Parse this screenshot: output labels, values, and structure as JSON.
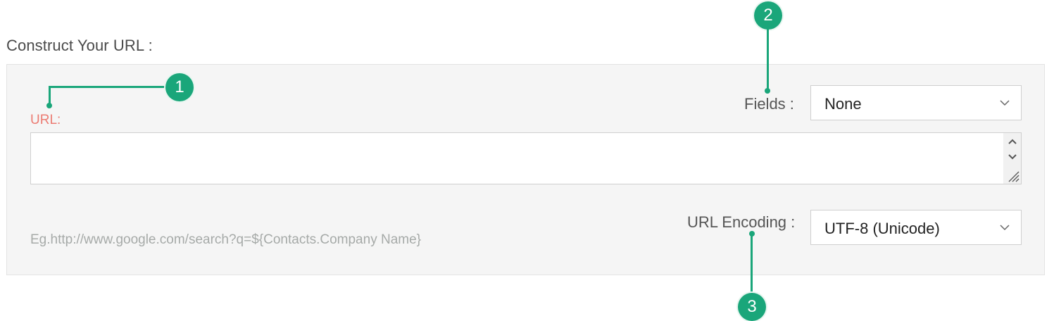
{
  "section_title": "Construct Your URL :",
  "url_field": {
    "label": "URL:",
    "value": "",
    "example": "Eg.http://www.google.com/search?q=${Contacts.Company Name}"
  },
  "fields": {
    "label": "Fields :",
    "selected": "None"
  },
  "url_encoding": {
    "label": "URL Encoding :",
    "selected": "UTF-8 (Unicode)"
  },
  "callouts": {
    "one": "1",
    "two": "2",
    "three": "3"
  },
  "colors": {
    "callout": "#1aa67a",
    "url_label": "#ec7b72",
    "panel_bg": "#f5f5f5"
  }
}
